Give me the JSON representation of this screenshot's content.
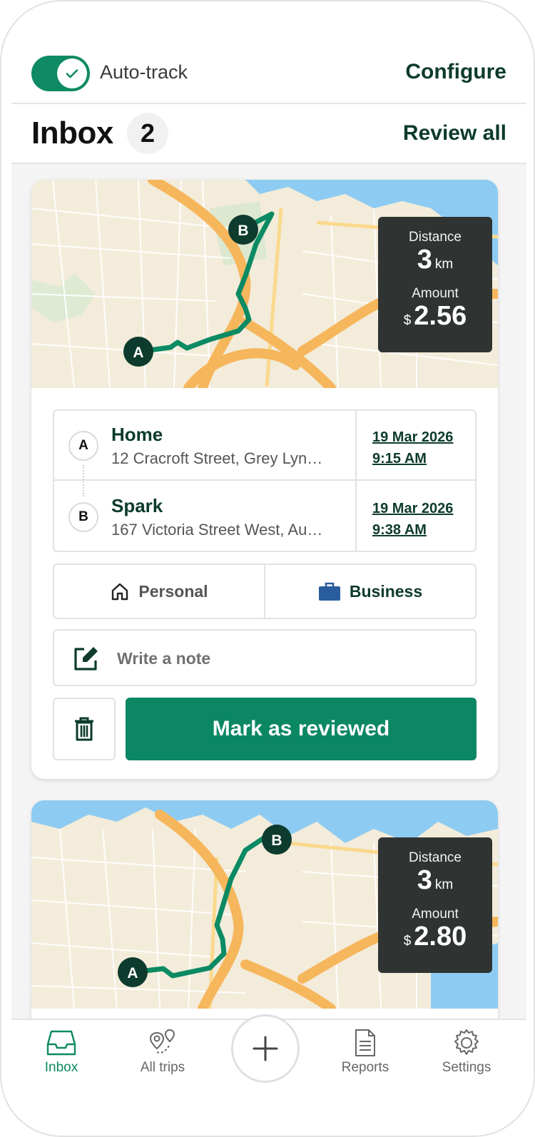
{
  "header": {
    "autotrack_label": "Auto-track",
    "autotrack_on": true,
    "configure_label": "Configure"
  },
  "inbox": {
    "title": "Inbox",
    "count": "2",
    "review_all_label": "Review all"
  },
  "trips": [
    {
      "distance_label": "Distance",
      "distance_value": "3",
      "distance_unit": "km",
      "amount_label": "Amount",
      "currency": "$",
      "amount_value": "2.56",
      "start": {
        "pin": "A",
        "name": "Home",
        "address": "12 Cracroft Street, Grey Lyn…",
        "date": "19 Mar 2026",
        "time": "9:15 AM"
      },
      "end": {
        "pin": "B",
        "name": "Spark",
        "address": "167 Victoria Street West, Au…",
        "date": "19 Mar 2026",
        "time": "9:38 AM"
      },
      "category_personal": "Personal",
      "category_business": "Business",
      "note_placeholder": "Write a note",
      "mark_reviewed_label": "Mark as reviewed"
    },
    {
      "distance_label": "Distance",
      "distance_value": "3",
      "distance_unit": "km",
      "amount_label": "Amount",
      "currency": "$",
      "amount_value": "2.80",
      "start": {
        "pin": "A"
      },
      "end": {
        "pin": "B"
      }
    }
  ],
  "nav": {
    "inbox": "Inbox",
    "all_trips": "All trips",
    "reports": "Reports",
    "settings": "Settings"
  },
  "colors": {
    "accent": "#0b8763",
    "dark_green": "#0d3b2e",
    "business_blue": "#2a5d9e",
    "route": "#0b8a63"
  }
}
